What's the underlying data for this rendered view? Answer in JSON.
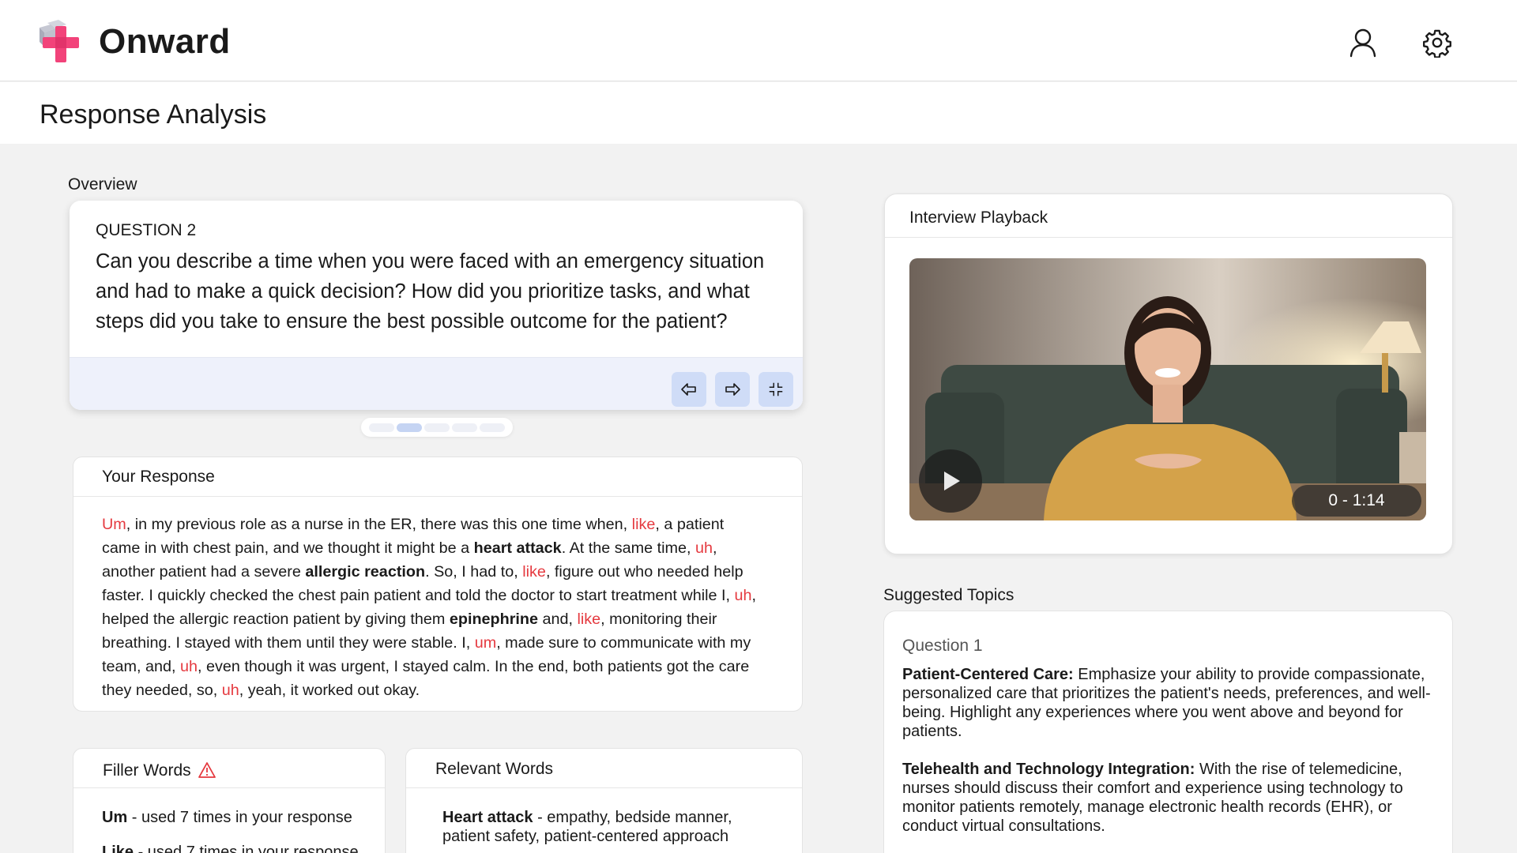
{
  "brand": {
    "name": "Onward",
    "colors": {
      "accent": "#f2437a",
      "cube": "#b9bcc9",
      "filler": "#e5393f"
    }
  },
  "header": {
    "user_icon": "user-icon",
    "settings_icon": "gear-icon"
  },
  "page": {
    "title": "Response Analysis"
  },
  "overview": {
    "label": "Overview",
    "question_number": "QUESTION 2",
    "question_text": "Can you describe a time when you were faced with an emergency situation and had to make a quick decision? How did you prioritize tasks, and what steps did you take to ensure the best possible outcome for the patient?",
    "pager": {
      "count": 5,
      "active": 2
    }
  },
  "response": {
    "title": "Your Response",
    "segments": [
      {
        "t": "Um",
        "s": "filler"
      },
      {
        "t": ", in my previous role as a nurse in the ER, there was this one time when, ",
        "s": "normal"
      },
      {
        "t": "like",
        "s": "filler"
      },
      {
        "t": ", a patient came in with chest pain, and we thought it might be a ",
        "s": "normal"
      },
      {
        "t": "heart attack",
        "s": "bold"
      },
      {
        "t": ". At the same time, ",
        "s": "normal"
      },
      {
        "t": "uh",
        "s": "filler"
      },
      {
        "t": ", another patient had a severe ",
        "s": "normal"
      },
      {
        "t": "allergic reaction",
        "s": "bold"
      },
      {
        "t": ". So, I had to, ",
        "s": "normal"
      },
      {
        "t": "like",
        "s": "filler"
      },
      {
        "t": ", figure out who needed help faster. I quickly checked the chest pain patient and told the doctor to start treatment while I, ",
        "s": "normal"
      },
      {
        "t": "uh",
        "s": "filler"
      },
      {
        "t": ", helped the allergic reaction patient by giving them ",
        "s": "normal"
      },
      {
        "t": "epinephrine",
        "s": "bold"
      },
      {
        "t": " and, ",
        "s": "normal"
      },
      {
        "t": "like",
        "s": "filler"
      },
      {
        "t": ", monitoring their breathing. I stayed with them until they were stable. I, ",
        "s": "normal"
      },
      {
        "t": "um",
        "s": "filler"
      },
      {
        "t": ", made sure to communicate with my team, and, ",
        "s": "normal"
      },
      {
        "t": "uh",
        "s": "filler"
      },
      {
        "t": ", even though it was urgent, I stayed calm. In the end, both patients got the care they needed, so, ",
        "s": "normal"
      },
      {
        "t": "uh",
        "s": "filler"
      },
      {
        "t": ", yeah, it worked out okay.",
        "s": "normal"
      }
    ]
  },
  "filler_words": {
    "title": "Filler Words",
    "warning_icon": "warning-icon",
    "items": [
      {
        "word": "Um",
        "desc": " - used 7 times in your response"
      },
      {
        "word": "Like",
        "desc": " - used 7 times in your response"
      }
    ]
  },
  "relevant_words": {
    "title": "Relevant Words",
    "items": [
      {
        "word": "Heart attack",
        "desc": " - empathy, bedside manner, patient safety, patient-centered approach"
      }
    ]
  },
  "playback": {
    "title": "Interview Playback",
    "time": "0 - 1:14",
    "play_icon": "play-icon"
  },
  "topics": {
    "label": "Suggested Topics",
    "question": "Question 1",
    "items": [
      {
        "title": "Patient-Centered Care:",
        "body": " Emphasize your ability to provide compassionate, personalized care that prioritizes the patient's needs, preferences, and well-being. Highlight any experiences where you went above and beyond for patients."
      },
      {
        "title": "Telehealth and Technology Integration:",
        "body": " With the rise of telemedicine, nurses should discuss their comfort and experience using technology to monitor patients remotely, manage electronic health records (EHR), or conduct virtual consultations."
      }
    ]
  }
}
